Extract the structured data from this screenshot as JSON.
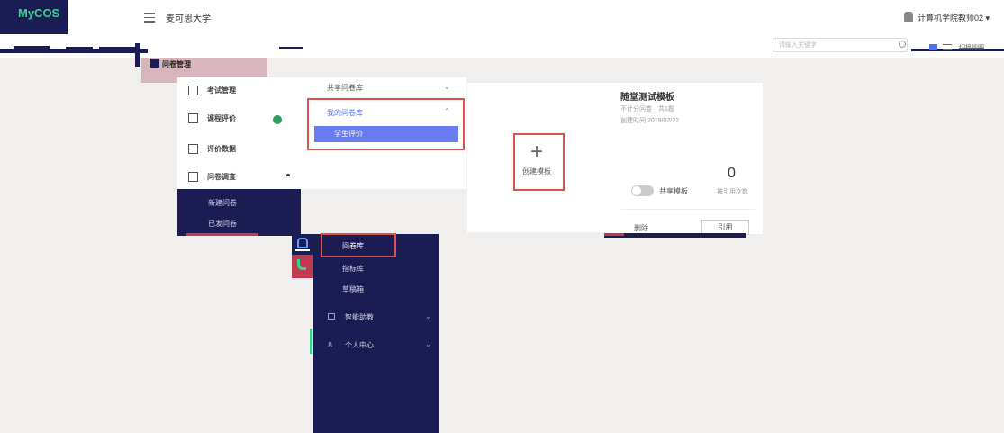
{
  "app": {
    "logo": "MyCOS",
    "school": "麦可思大学",
    "user_name": "计算机学院教师02 ▾"
  },
  "toolbar": {
    "search_placeholder": "请输入关键字",
    "switch_view": "切换视图"
  },
  "top_tab": {
    "label": "问卷管理"
  },
  "left_menu": {
    "items": [
      {
        "label": "考试管理"
      },
      {
        "label": "课程评价"
      },
      {
        "label": "评价数据"
      },
      {
        "label": "问卷调查"
      }
    ],
    "sub_items": [
      {
        "label": "新建问卷"
      },
      {
        "label": "已发问卷"
      }
    ]
  },
  "question_bank": {
    "shared_lib": "共享问卷库",
    "my_lib": "我的问卷库",
    "student_eval": "学生评价"
  },
  "create_card": {
    "label": "创建模板"
  },
  "template_card": {
    "title": "随堂测试模板",
    "meta": "不计分问卷　共1题",
    "date": "创建时间 2019/02/22",
    "count": "0",
    "count_label": "被引用次数",
    "share_label": "共享模板",
    "delete_label": "删除",
    "use_label": "引用"
  },
  "dark_sidebar": {
    "items": [
      {
        "label": "问卷库",
        "active": true
      },
      {
        "label": "指标库"
      },
      {
        "label": "草稿箱"
      },
      {
        "label": "智能助教"
      },
      {
        "label": "个人中心"
      }
    ]
  },
  "colors": {
    "nav_dark": "#1c1c54",
    "accent_blue": "#6a7cf2",
    "highlight_red": "#d9534f",
    "brand_green": "#3ad28f"
  }
}
